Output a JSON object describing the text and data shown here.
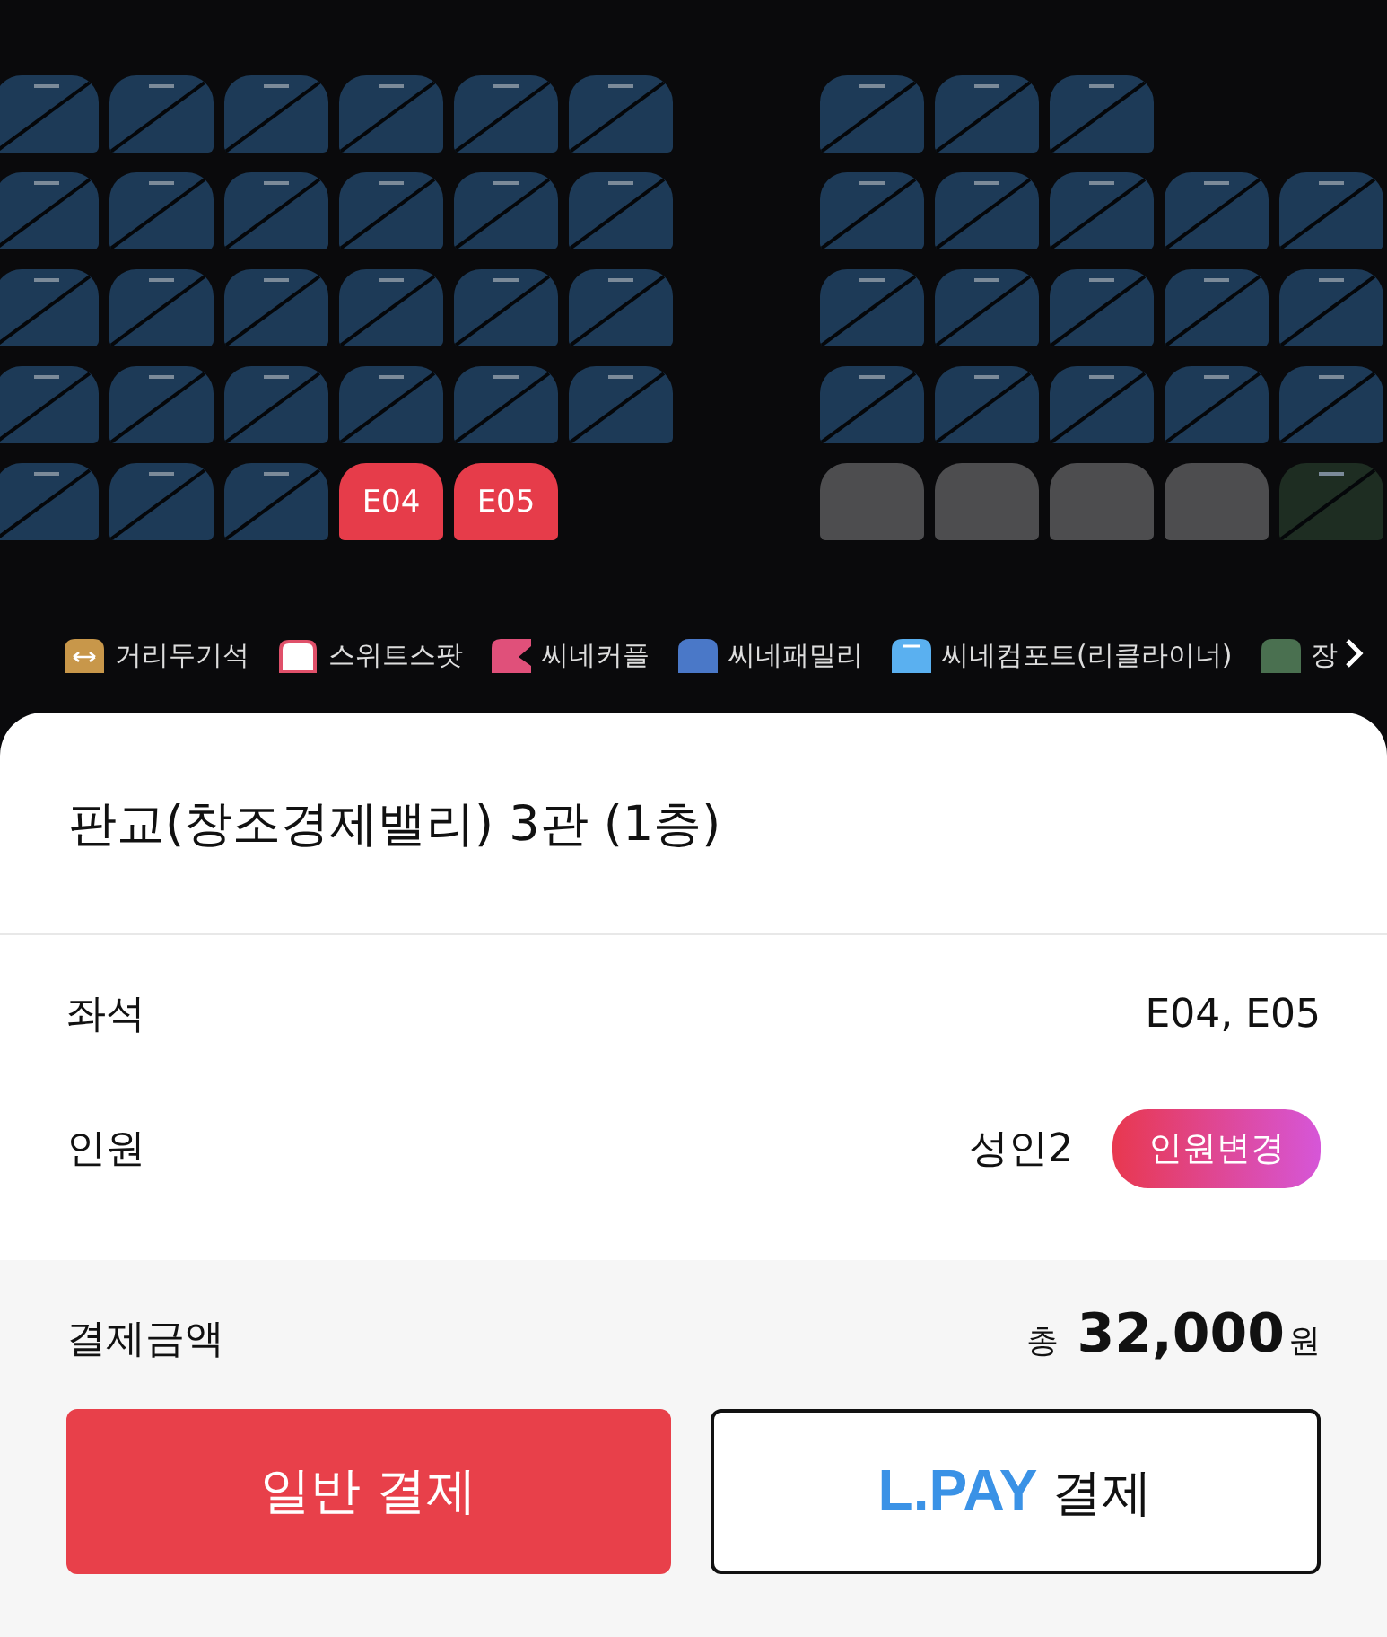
{
  "seat_blocks": [
    {
      "rows": [
        {
          "seats": [
            {
              "kind": "sold",
              "color": "#1d3a57",
              "selected": false
            },
            {
              "kind": "sold",
              "color": "#1d3a57",
              "selected": false
            },
            {
              "kind": "sold",
              "color": "#1d3a57",
              "selected": false
            },
            {
              "kind": "sold",
              "color": "#1d3a57",
              "selected": false
            },
            {
              "kind": "sold",
              "color": "#1d3a57",
              "selected": false
            },
            {
              "kind": "sold",
              "color": "#1d3a57",
              "selected": false
            }
          ]
        },
        {
          "seats": [
            {
              "kind": "sold",
              "color": "#1d3a57",
              "selected": false
            },
            {
              "kind": "sold",
              "color": "#1d3a57",
              "selected": false
            },
            {
              "kind": "sold",
              "color": "#1d3a57",
              "selected": false
            },
            {
              "kind": "sold",
              "color": "#1d3a57",
              "selected": false
            },
            {
              "kind": "sold",
              "color": "#1d3a57",
              "selected": false
            },
            {
              "kind": "sold",
              "color": "#1d3a57",
              "selected": false
            }
          ]
        },
        {
          "seats": [
            {
              "kind": "sold",
              "color": "#1d3a57",
              "selected": false
            },
            {
              "kind": "sold",
              "color": "#1d3a57",
              "selected": false
            },
            {
              "kind": "sold",
              "color": "#1d3a57",
              "selected": false
            },
            {
              "kind": "sold",
              "color": "#1d3a57",
              "selected": false
            },
            {
              "kind": "sold",
              "color": "#1d3a57",
              "selected": false
            },
            {
              "kind": "sold",
              "color": "#1d3a57",
              "selected": false
            }
          ]
        },
        {
          "seats": [
            {
              "kind": "sold",
              "color": "#1d3a57",
              "selected": false
            },
            {
              "kind": "sold",
              "color": "#1d3a57",
              "selected": false
            },
            {
              "kind": "sold",
              "color": "#1d3a57",
              "selected": false
            },
            {
              "kind": "sold",
              "color": "#1d3a57",
              "selected": false
            },
            {
              "kind": "sold",
              "color": "#1d3a57",
              "selected": false
            },
            {
              "kind": "sold",
              "color": "#1d3a57",
              "selected": false
            }
          ]
        },
        {
          "seats": [
            {
              "kind": "sold",
              "color": "#1d3a57",
              "selected": false
            },
            {
              "kind": "sold",
              "color": "#1d3a57",
              "selected": false
            },
            {
              "kind": "sold",
              "color": "#1d3a57",
              "selected": false
            },
            {
              "kind": "available",
              "label": "E04",
              "selected": true
            },
            {
              "kind": "available",
              "label": "E05",
              "selected": true
            }
          ]
        }
      ]
    },
    {
      "rows": [
        {
          "seats": [
            {
              "kind": "sold",
              "color": "#1d3a57",
              "selected": false
            },
            {
              "kind": "sold",
              "color": "#1d3a57",
              "selected": false
            },
            {
              "kind": "sold",
              "color": "#1d3a57",
              "selected": false
            }
          ]
        },
        {
          "seats": [
            {
              "kind": "sold",
              "color": "#1d3a57",
              "selected": false
            },
            {
              "kind": "sold",
              "color": "#1d3a57",
              "selected": false
            },
            {
              "kind": "sold",
              "color": "#1d3a57",
              "selected": false
            },
            {
              "kind": "sold",
              "color": "#1d3a57",
              "selected": false
            },
            {
              "kind": "sold",
              "color": "#1d3a57",
              "selected": false
            }
          ]
        },
        {
          "seats": [
            {
              "kind": "sold",
              "color": "#1d3a57",
              "selected": false
            },
            {
              "kind": "sold",
              "color": "#1d3a57",
              "selected": false
            },
            {
              "kind": "sold",
              "color": "#1d3a57",
              "selected": false
            },
            {
              "kind": "sold",
              "color": "#1d3a57",
              "selected": false
            },
            {
              "kind": "sold",
              "color": "#1d3a57",
              "selected": false
            }
          ]
        },
        {
          "seats": [
            {
              "kind": "sold",
              "color": "#1d3a57",
              "selected": false
            },
            {
              "kind": "sold",
              "color": "#1d3a57",
              "selected": false
            },
            {
              "kind": "sold",
              "color": "#1d3a57",
              "selected": false
            },
            {
              "kind": "sold",
              "color": "#1d3a57",
              "selected": false
            },
            {
              "kind": "sold",
              "color": "#1d3a57",
              "selected": false
            }
          ]
        },
        {
          "seats": [
            {
              "kind": "blocked",
              "selected": false
            },
            {
              "kind": "blocked",
              "selected": false
            },
            {
              "kind": "blocked",
              "selected": false
            },
            {
              "kind": "blocked",
              "selected": false
            },
            {
              "kind": "sold",
              "color": "#1e2d22",
              "selected": false
            }
          ]
        }
      ]
    }
  ],
  "legend": [
    {
      "kind": "distance",
      "label": "거리두기석",
      "color": "#c8974a"
    },
    {
      "kind": "outlined",
      "label": "스위트스팟",
      "color": "#e0506a"
    },
    {
      "kind": "notched",
      "label": "씨네커플",
      "color": "#e0507a"
    },
    {
      "kind": "plain",
      "label": "씨네패밀리",
      "color": "#4a78c8"
    },
    {
      "kind": "lined",
      "label": "씨네컴포트(리클라이너)",
      "color": "#5ab0f0"
    },
    {
      "kind": "plain",
      "label": "장",
      "color": "#4a7050"
    }
  ],
  "sheet": {
    "title": "판교(창조경제밸리) 3관 (1층)",
    "seat_row": {
      "label": "좌석",
      "value": "E04, E05"
    },
    "people_row": {
      "label": "인원",
      "value": "성인2",
      "button": "인원변경"
    },
    "payment": {
      "label": "결제금액",
      "prefix": "총",
      "amount": "32,000",
      "suffix": "원"
    },
    "buttons": [
      {
        "kind": "primary",
        "label": "일반 결제"
      },
      {
        "kind": "lpay",
        "brand": "L.PAY",
        "label": "결제"
      }
    ]
  }
}
